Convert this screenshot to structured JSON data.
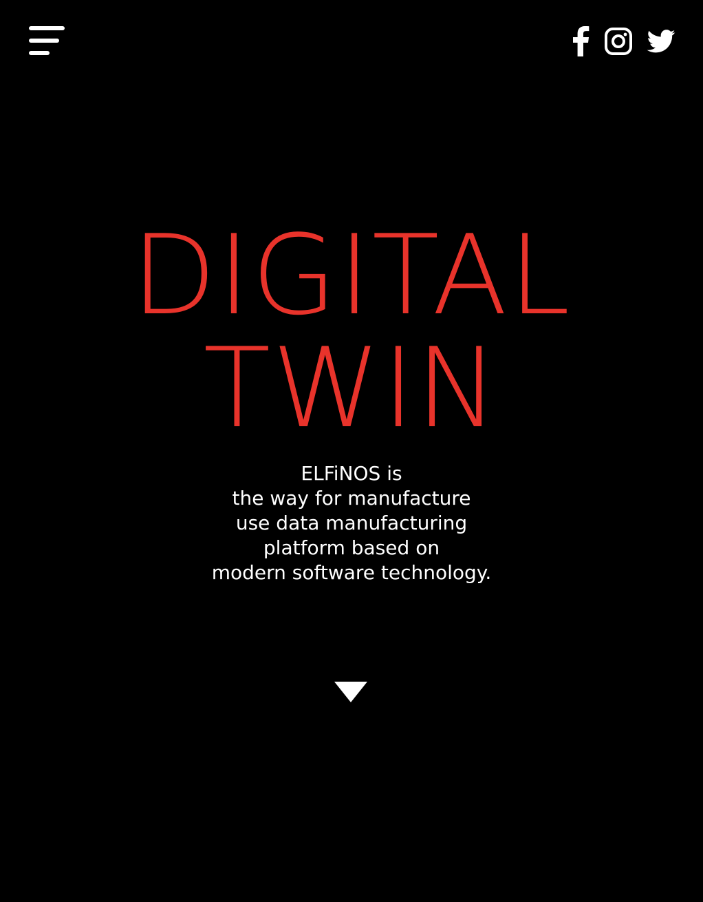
{
  "header": {
    "menu_icon": "hamburger-menu-icon",
    "social": [
      {
        "name": "facebook",
        "icon": "facebook-icon"
      },
      {
        "name": "instagram",
        "icon": "instagram-icon"
      },
      {
        "name": "twitter",
        "icon": "twitter-icon"
      }
    ]
  },
  "hero": {
    "title_line1": "DIGITAL",
    "title_line2": "TWIN",
    "title_color": "#e8332b"
  },
  "intro": {
    "lines": [
      "ELFiNOS is",
      "the way for manufacture",
      "use data manufacturing",
      "platform based on",
      "modern software technology."
    ]
  },
  "scroll": {
    "icon": "triangle-down-icon"
  },
  "colors": {
    "background": "#000000",
    "text": "#ffffff",
    "accent": "#e8332b"
  }
}
